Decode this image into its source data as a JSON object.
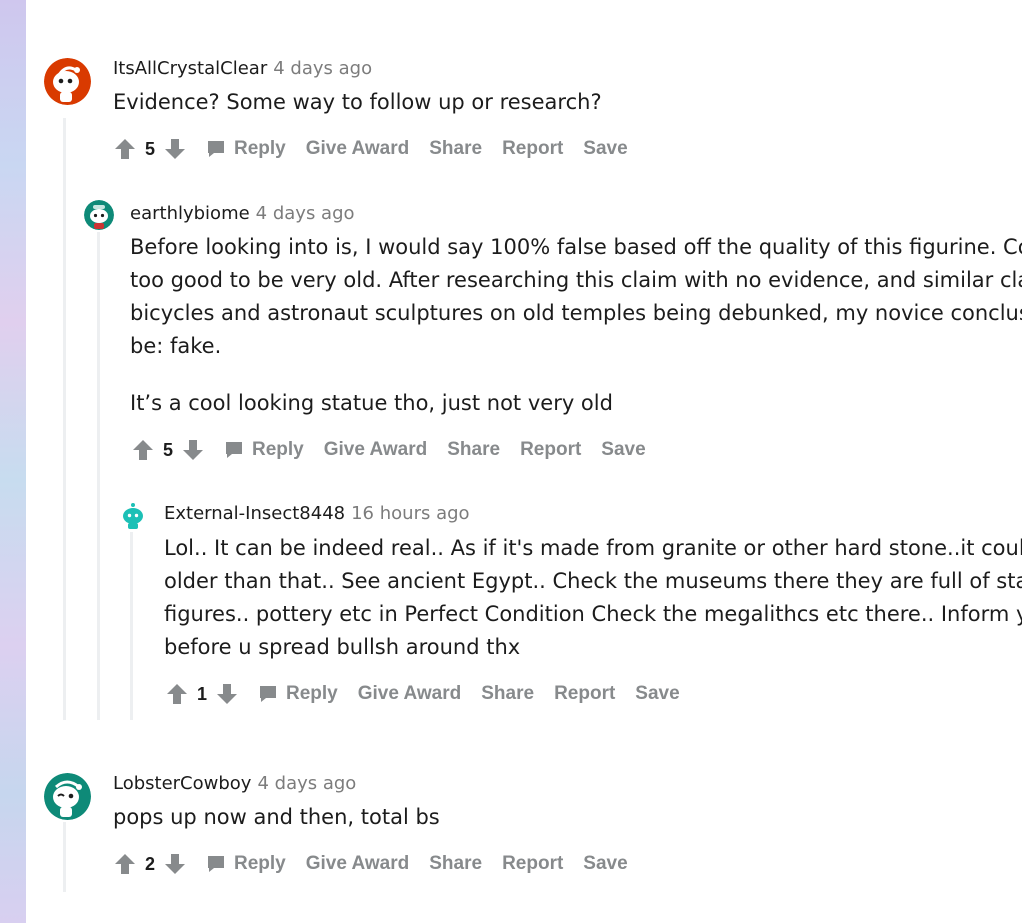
{
  "comments": [
    {
      "username": "ItsAllCrystalClear",
      "timestamp": "4 days ago",
      "lines": [
        "Evidence? Some way to follow up or research?"
      ],
      "score": "5",
      "avatar_color": "#d93a00"
    },
    {
      "username": "earthlybiome",
      "timestamp": "4 days ago",
      "lines": [
        "Before looking into is, I would say 100% false based off the quality of this figurine. Co",
        "too good to be very old. After researching this claim with no evidence, and similar cla",
        "bicycles and astronaut sculptures on old temples being debunked, my novice conclus",
        "be: fake.",
        "It’s a cool looking statue tho, just not very old"
      ],
      "score": "5",
      "avatar_color": "#0e8a78"
    },
    {
      "username": "External-Insect8448",
      "timestamp": "16 hours ago",
      "lines": [
        "Lol.. It can be indeed real.. As if it's made from granite or other hard stone..it could",
        "older than that.. See ancient Egypt.. Check the museums there they are full of stat",
        "figures.. pottery etc in Perfect Condition Check the megalithcs etc there.. Inform yo",
        "before u spread bullsh around thx"
      ],
      "score": "1",
      "avatar_color": "#1cc0b6"
    },
    {
      "username": "LobsterCowboy",
      "timestamp": "4 days ago",
      "lines": [
        "pops up now and then, total bs"
      ],
      "score": "2",
      "avatar_color": "#0e8a78"
    }
  ],
  "actions": {
    "reply": "Reply",
    "give_award": "Give Award",
    "share": "Share",
    "report": "Report",
    "save": "Save"
  },
  "colors": {
    "action_text": "#878a8c",
    "thread_line": "#edeff1",
    "meta_time": "#7c7c7c"
  }
}
